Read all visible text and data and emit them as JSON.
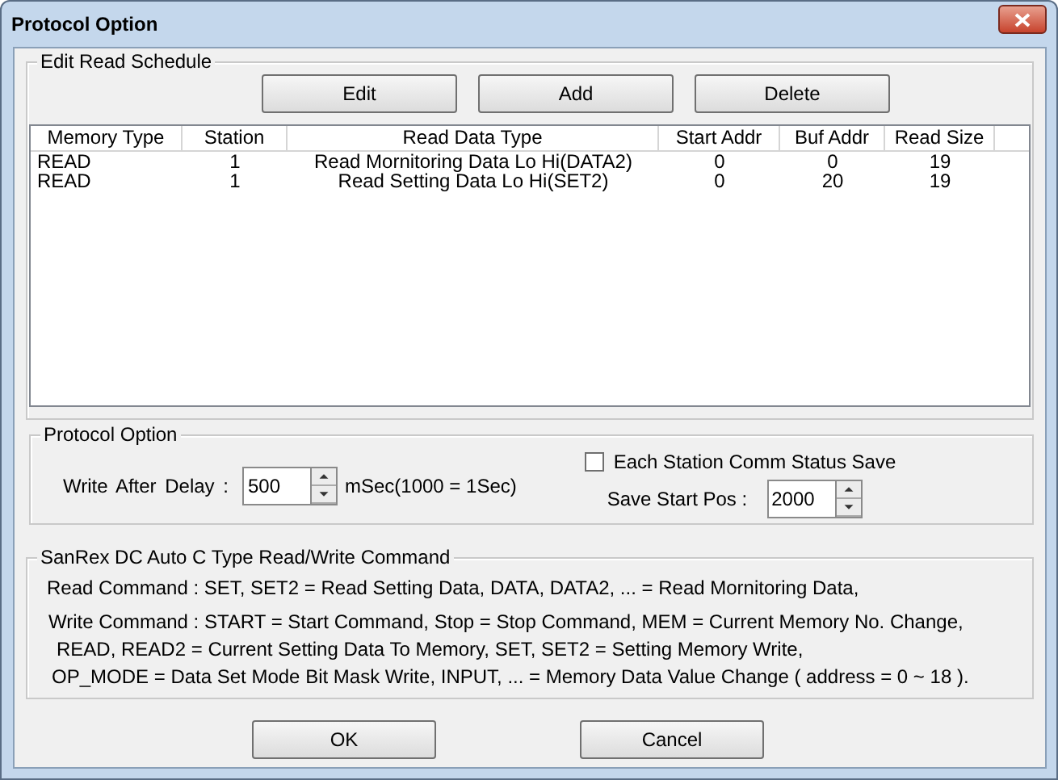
{
  "window": {
    "title": "Protocol Option"
  },
  "schedule": {
    "title": "Edit Read Schedule",
    "buttons": [
      "Edit",
      "Add",
      "Delete"
    ],
    "columns": [
      "Memory Type",
      "Station",
      "Read Data Type",
      "Start Addr",
      "Buf Addr",
      "Read Size"
    ],
    "rows": [
      [
        "READ",
        "1",
        "Read Mornitoring Data Lo Hi(DATA2)",
        "0",
        "0",
        "19"
      ],
      [
        "READ",
        "1",
        "Read Setting Data Lo Hi(SET2)",
        "0",
        "20",
        "19"
      ]
    ]
  },
  "protocol_option": {
    "title": "Protocol Option",
    "delay_label": "Write After Delay :",
    "delay_value": "500",
    "delay_unit": "mSec(1000 = 1Sec)",
    "station_save": {
      "label": "Each Station Comm Status Save",
      "checked": false
    },
    "start_label": "Save Start Pos :",
    "start_value": "2000"
  },
  "command": {
    "title": "SanRex DC Auto C Type Read/Write Command",
    "lines": [
      "Read Command : SET, SET2 = Read Setting Data,  DATA, DATA2, ... = Read Mornitoring Data,",
      "Write Command : START = Start Command, Stop = Stop Command, MEM = Current Memory No. Change,",
      "READ, READ2 = Current Setting Data To Memory, SET, SET2 = Setting Memory Write,",
      "OP_MODE = Data Set Mode Bit Mask Write, INPUT, ... = Memory Data Value Change ( address = 0 ~ 18 )."
    ]
  },
  "buttons": [
    "OK",
    "Cancel"
  ]
}
